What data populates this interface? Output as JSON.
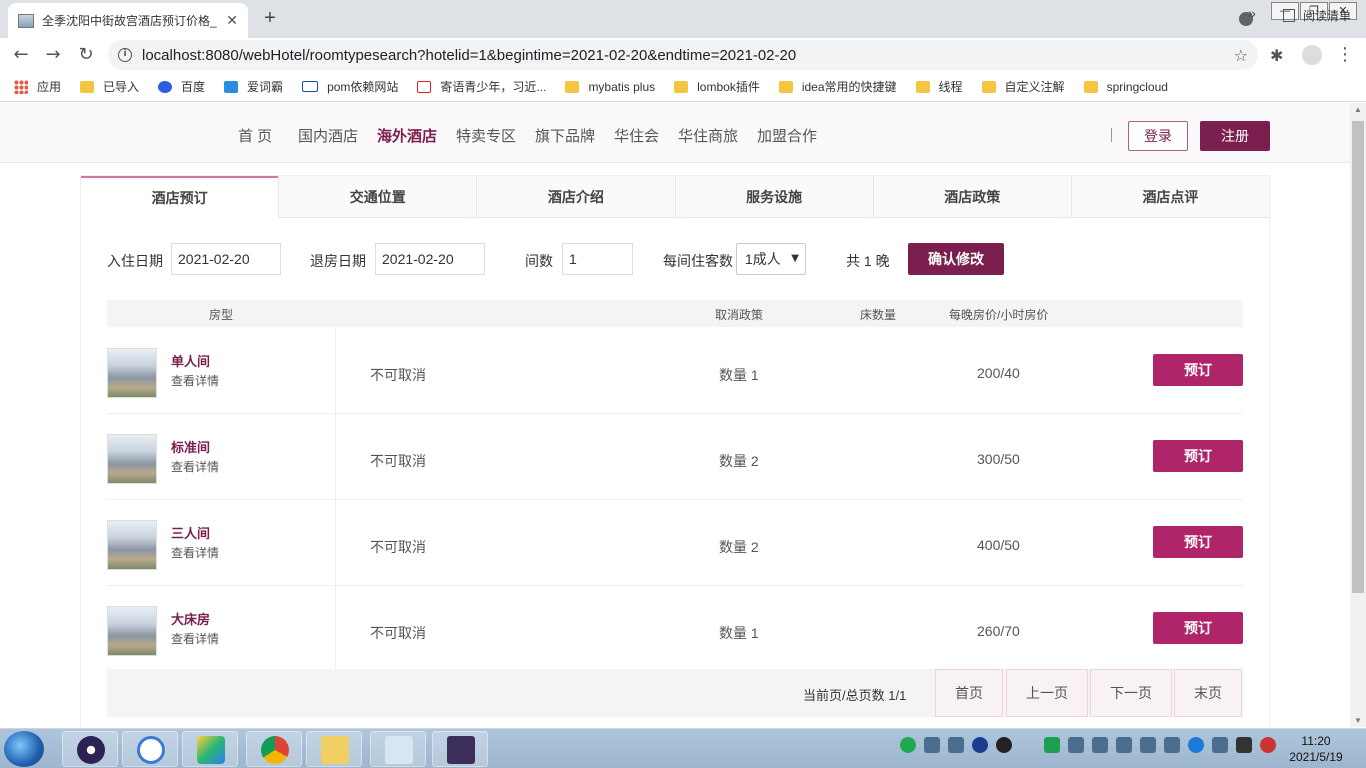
{
  "browser": {
    "tab_title": "全季沈阳中街故宫酒店预订价格_",
    "tab_close": "✕",
    "new_tab": "+",
    "back": "←",
    "forward": "→",
    "reload": "↻",
    "url": "localhost:8080/webHotel/roomtypesearch?hotelid=1&begintime=2021-02-20&endtime=2021-02-20",
    "bookmarks": [
      {
        "label": "应用",
        "icon": "apps-grid-icon"
      },
      {
        "label": "已导入",
        "icon": "folder-icon"
      },
      {
        "label": "百度",
        "icon": "baidu-paw-icon"
      },
      {
        "label": "爱词霸",
        "icon": "iciba-icon"
      },
      {
        "label": "pom依赖网站",
        "icon": "mvn-icon"
      },
      {
        "label": "寄语青少年，习近...",
        "icon": "article-icon"
      },
      {
        "label": "mybatis plus",
        "icon": "folder-icon"
      },
      {
        "label": "lombok插件",
        "icon": "folder-icon"
      },
      {
        "label": "idea常用的快捷键",
        "icon": "folder-icon"
      },
      {
        "label": "线程",
        "icon": "folder-icon"
      },
      {
        "label": "自定义注解",
        "icon": "folder-icon"
      },
      {
        "label": "springcloud",
        "icon": "folder-icon"
      }
    ],
    "bookmarks_more": "»",
    "reading_list": "阅读清单"
  },
  "site_nav": {
    "items": [
      "首 页",
      "国内酒店",
      "海外酒店",
      "特卖专区",
      "旗下品牌",
      "华住会",
      "华住商旅",
      "加盟合作"
    ],
    "active_index": 2,
    "login": "登录",
    "register": "注册"
  },
  "tabs": [
    "酒店预订",
    "交通位置",
    "酒店介绍",
    "服务设施",
    "酒店政策",
    "酒店点评"
  ],
  "filter": {
    "checkin_label": "入住日期",
    "checkin_value": "2021-02-20",
    "checkout_label": "退房日期",
    "checkout_value": "2021-02-20",
    "rooms_label": "间数",
    "rooms_value": "1",
    "guests_label": "每间住客数",
    "guests_value": "1成人",
    "nights_text": "共 1 晚",
    "confirm": "确认修改"
  },
  "table": {
    "headers": {
      "type": "房型",
      "cancel": "取消政策",
      "beds": "床数量",
      "price": "每晚房价/小时房价"
    },
    "rows": [
      {
        "name": "单人间",
        "detail": "查看详情",
        "cancel": "不可取消",
        "beds": "数量 1",
        "price": "200/40",
        "book": "预订"
      },
      {
        "name": "标准间",
        "detail": "查看详情",
        "cancel": "不可取消",
        "beds": "数量 2",
        "price": "300/50",
        "book": "预订"
      },
      {
        "name": "三人间",
        "detail": "查看详情",
        "cancel": "不可取消",
        "beds": "数量 2",
        "price": "400/50",
        "book": "预订"
      },
      {
        "name": "大床房",
        "detail": "查看详情",
        "cancel": "不可取消",
        "beds": "数量 1",
        "price": "260/70",
        "book": "预订"
      }
    ]
  },
  "pager": {
    "info": "当前页/总页数 1/1",
    "first": "首页",
    "prev": "上一页",
    "next": "下一页",
    "last": "末页"
  },
  "taskbar": {
    "clock_time": "11:20",
    "clock_date": "2021/5/19"
  },
  "colors": {
    "brand": "#7b1f4e",
    "book_button": "#b0246a",
    "tab_accent": "#d873a5"
  }
}
